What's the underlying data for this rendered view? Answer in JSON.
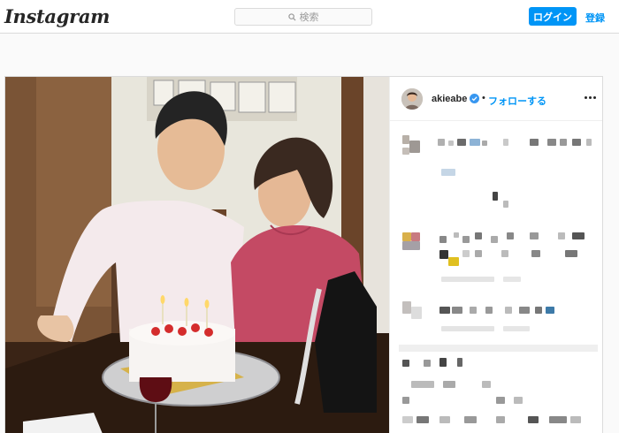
{
  "header": {
    "logo": "Instagram",
    "search_placeholder": "検索",
    "login_label": "ログイン",
    "signup_label": "登録"
  },
  "post": {
    "username": "akieabe",
    "separator": "•",
    "follow_label": "フォローする"
  },
  "colors": {
    "accent": "#0095f6",
    "border": "#dbdbdb",
    "background": "#fafafa"
  },
  "icons": [
    "search-icon",
    "verified-badge-icon",
    "more-options-icon"
  ]
}
